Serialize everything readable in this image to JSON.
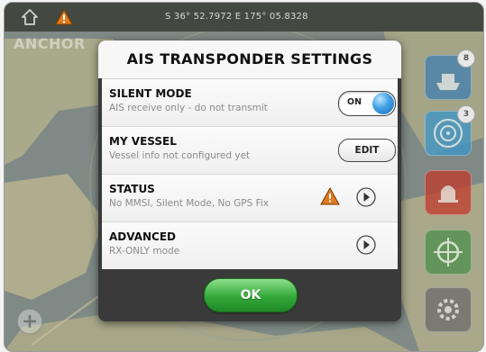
{
  "statusbar": {
    "coordinates": "S 36° 52.7972   E 175° 05.8328",
    "home_icon": "home-icon",
    "warning_icon": "warning-icon"
  },
  "map": {
    "label": "ANCHOR"
  },
  "side_buttons": {
    "badge_1": "8",
    "badge_2": "3"
  },
  "dialog": {
    "title": "AIS TRANSPONDER SETTINGS",
    "rows": [
      {
        "title": "SILENT MODE",
        "subtitle": "AIS receive only - do not transmit",
        "control_label": "ON"
      },
      {
        "title": "MY VESSEL",
        "subtitle": "Vessel info not configured yet",
        "control_label": "EDIT"
      },
      {
        "title": "STATUS",
        "subtitle": "No MMSI, Silent Mode, No GPS Fix"
      },
      {
        "title": "ADVANCED",
        "subtitle": "RX-ONLY mode"
      }
    ],
    "ok_label": "OK"
  },
  "colors": {
    "ok_green": "#34a83a",
    "toggle_blue": "#3fa0e6",
    "warning_orange": "#e07a1f",
    "dialog_bg": "#3a3a3a"
  }
}
